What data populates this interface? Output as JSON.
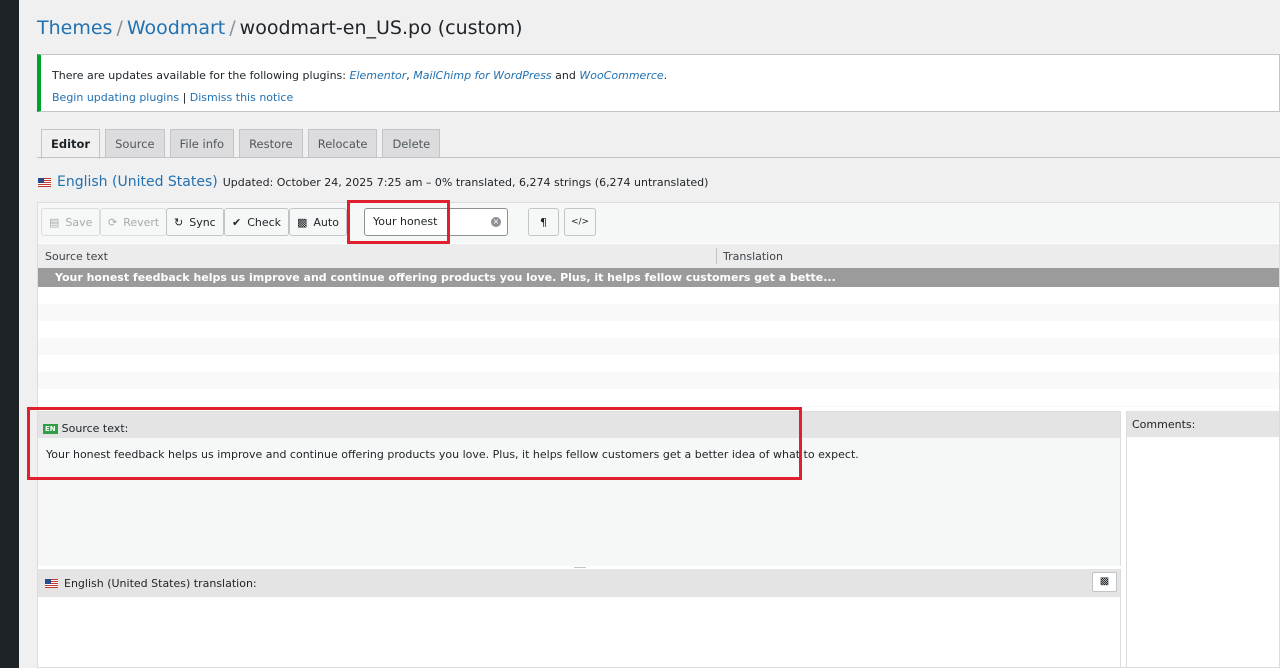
{
  "breadcrumb": {
    "themes": "Themes",
    "theme": "Woodmart",
    "file": "woodmart-en_US.po (custom)",
    "sep": "/"
  },
  "notice": {
    "intro": "There are updates available for the following plugins: ",
    "plugin1": "Elementor",
    "comma": ", ",
    "plugin2": "MailChimp for WordPress",
    "and": " and ",
    "plugin3": "WooCommerce",
    "dot": ".",
    "begin_link": "Begin updating plugins",
    "pipe": " | ",
    "dismiss_link": "Dismiss this notice",
    "accent_color": "#00a32a"
  },
  "tabs": [
    {
      "label": "Editor",
      "active": true
    },
    {
      "label": "Source",
      "active": false
    },
    {
      "label": "File info",
      "active": false
    },
    {
      "label": "Restore",
      "active": false
    },
    {
      "label": "Relocate",
      "active": false
    },
    {
      "label": "Delete",
      "active": false
    }
  ],
  "locale": {
    "name": "English (United States)",
    "status": "Updated: October 24, 2025 7:25 am – 0% translated, 6,274 strings (6,274 untranslated)"
  },
  "toolbar": {
    "save": "Save",
    "revert": "Revert",
    "sync": "Sync",
    "check": "Check",
    "auto": "Auto",
    "search_value": "Your honest",
    "pilcrow": "¶",
    "code": "</>"
  },
  "grid": {
    "col_source": "Source text",
    "col_translation": "Translation",
    "selected_row": "Your honest feedback helps us improve and continue offering products you love. Plus, it helps fellow customers get a bette..."
  },
  "source_pane": {
    "badge": "EN",
    "label": "Source text:",
    "text": "Your honest feedback helps us improve and continue offering products you love. Plus, it helps fellow customers get a better idea of what to expect."
  },
  "translation_pane": {
    "label": "English (United States) translation:"
  },
  "comments_pane": {
    "label": "Comments:"
  },
  "colors": {
    "link": "#2271b1",
    "highlight_red": "#e0202c",
    "selected_row": "#9b9b9b"
  }
}
